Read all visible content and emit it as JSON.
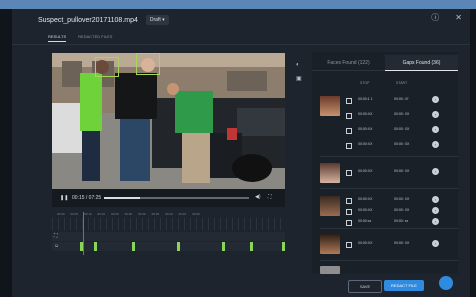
{
  "header": {
    "filename": "Suspect_pullover20171108.mp4",
    "status": "Draft",
    "help_icon": "help-icon",
    "close_icon": "close-icon"
  },
  "subtabs": [
    "RESULTS",
    "REDACTED FILES"
  ],
  "video": {
    "time": "00:15 / 07:25",
    "play_icon": "pause-icon",
    "volume_icon": "volume-icon",
    "fullscreen_icon": "fullscreen-icon",
    "progress": 0.25
  },
  "timeline": {
    "ticks": [
      "00:00",
      "00:05",
      "00:10",
      "00:15",
      "00:20",
      "00:25",
      "00:30",
      "00:35",
      "00:40",
      "00:45",
      "00:50"
    ]
  },
  "panel": {
    "tabs": [
      "Faces Found (122)",
      "Gaps Found (36)"
    ],
    "columns": {
      "stop": "STOP",
      "start": "START"
    },
    "rows": [
      {
        "stop": "00:00:1 1",
        "start": "00:00: 47"
      },
      {
        "stop": "00:00:XX",
        "start": "00:00: XX"
      },
      {
        "stop": "00:00:XX",
        "start": "00:00: XX"
      },
      {
        "stop": "00:00:XX",
        "start": "00:00: XX"
      },
      {
        "stop": "00:00:XX",
        "start": "00:00: XX"
      },
      {
        "stop": "00:00:XX",
        "start": "00:00: XX"
      },
      {
        "stop": "00:00:XX",
        "start": "00:00: XX"
      },
      {
        "stop": "00:00:xx",
        "start": "00:00: xx"
      },
      {
        "stop": "00:00:XX",
        "start": "00:00: XX"
      }
    ]
  },
  "footer": {
    "save": "SAVE",
    "redact": "REDACT FILE"
  },
  "colors": {
    "accent": "#2f8be0",
    "detect_box": "#a7d65a",
    "marker": "#8bd65a"
  }
}
